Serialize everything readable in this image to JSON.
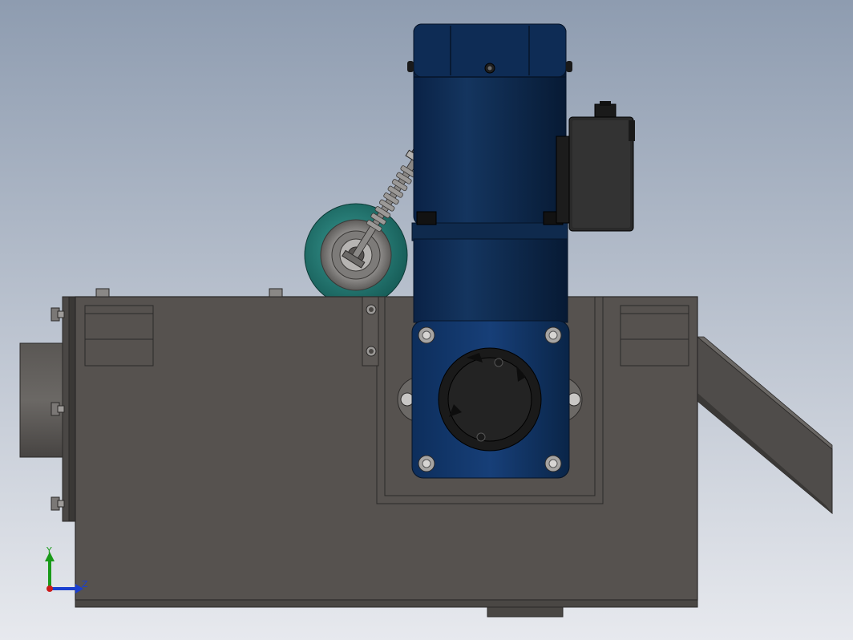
{
  "viewport": {
    "background_top": "#8e9cb0",
    "background_bottom": "#e7e9ee"
  },
  "colors": {
    "housing": "#56524f",
    "housing_edge": "#2b2928",
    "motor_blue": "#0f2a4d",
    "motor_blue_dark": "#081a33",
    "gear_head_blue": "#123a70",
    "terminal_box": "#2a2a2a",
    "roller_teal": "#1f6f6a",
    "bearing_grey": "#9a9896",
    "chute_grey": "#4f4c4a"
  },
  "triad": {
    "y_label": "Y",
    "z_label": "Z",
    "y_color": "#1a9a1a",
    "z_color": "#1a3fd0",
    "origin_color": "#cc1a1a"
  },
  "icons": {
    "view_triad": "xyz-triad-icon"
  }
}
